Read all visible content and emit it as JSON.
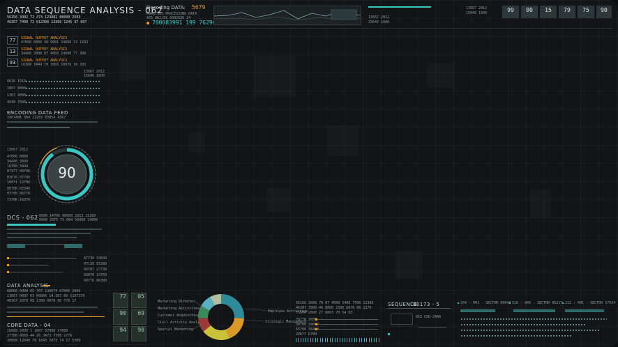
{
  "header": {
    "title": "DATA SEQUENCE ANALYSIS - 062",
    "line1": "56156 3002 72 474 123882 80000 2503",
    "line2": "46367 7400 72 012306 13366 1245 97 007",
    "decoding_label": "Decoding DATA",
    "decoding_value": "5679",
    "sub1": "ANALYSIS PROCESSING DATA",
    "sub2": "425 062/9X 0302626 24",
    "long_number": "700083991 199 762909",
    "right_small1": "13667 2012",
    "right_small2": "15646 1600",
    "counters": [
      "99",
      "00",
      "15",
      "79",
      "75",
      "90"
    ]
  },
  "left_top": {
    "rows": [
      {
        "num": "77",
        "label": "SIGNAL OUTPUT ANALYSIS"
      },
      {
        "num": "13",
        "label": "SIGNAL OUTPUT ANALYSIS"
      },
      {
        "num": "93",
        "label": "SIGNAL OUTPUT ANALYSIS"
      }
    ]
  },
  "encoding": {
    "title": "ENCODING DATA FEED",
    "sub": "1067406 304 12203 03054 4367"
  },
  "gauge": {
    "value": "90",
    "left_labels": [
      "13667 2012",
      "47006 0000",
      "34406 3000",
      "16300 3444",
      "07977 00700",
      "03676 07700",
      "10671 12700",
      "00706 03346",
      "03706 06770",
      "73706 16376"
    ]
  },
  "dcs": {
    "title": "DCS - 062",
    "line1": "0000 14700 00000 2013 15260",
    "line2": "0000 2075 75.004 56000 14000",
    "right_values": [
      "07730 33030",
      "07130 55300",
      "00707 27730",
      "03070 14703",
      "00776 06300"
    ]
  },
  "data_analysis": {
    "title": "DATA ANALYSIS",
    "lines": [
      "68066 0000 65 707 130074 07000 2000",
      "13667 0007 63 00066 14 307 00 1107370",
      "46367 2078 08 1300 0070 00 770 17"
    ]
  },
  "core_data": {
    "title": "CORE DATA - 04",
    "lines": [
      "16068 2000 1 1007 07000 17000",
      "27706 0060 44 26 3473 7700 1776",
      "30008 12048 76 1043 2073 74 17 5306"
    ]
  },
  "tiles": [
    "77",
    "05",
    "90",
    "69",
    "94",
    "90"
  ],
  "donut": {
    "left_labels": [
      "Marketing Director",
      "Marketing Activities",
      "Customer Acquisition",
      "Civil Activity Analysis",
      "Spatial Marketing"
    ],
    "right_labels": [
      "Employee Activities",
      "Strategic Management"
    ],
    "segments": [
      {
        "value": 26,
        "color": "#2f8a9a"
      },
      {
        "value": 18,
        "color": "#d99a2a"
      },
      {
        "value": 20,
        "color": "#c9c23a"
      },
      {
        "value": 10,
        "color": "#9a3a3a"
      },
      {
        "value": 9,
        "color": "#3a8a5a"
      },
      {
        "value": 9,
        "color": "#5ab0c0"
      },
      {
        "value": 8,
        "color": "#b0c0a0"
      }
    ]
  },
  "mid_bottom": {
    "head1": "56166 3000 78 87 4000 1400 7500 12300",
    "head2": "46307 7000 46 8000 1506 6070 00 1370",
    "head3": "75604 2000 27 6003 70 54 03",
    "rows": [
      "76770 3000",
      "30700 34047",
      "65700 36400",
      "20677 6700"
    ]
  },
  "sequence": {
    "title": "SEQUENCE",
    "value": "00173 - 5",
    "sub": "0X3 COD-2466"
  },
  "sector_panel": {
    "headers": [
      "204 : 001 - SECTOR 00044",
      "216 : 466 - SECTOR 06217",
      "212 : 001 - SECTOR 17024"
    ]
  }
}
